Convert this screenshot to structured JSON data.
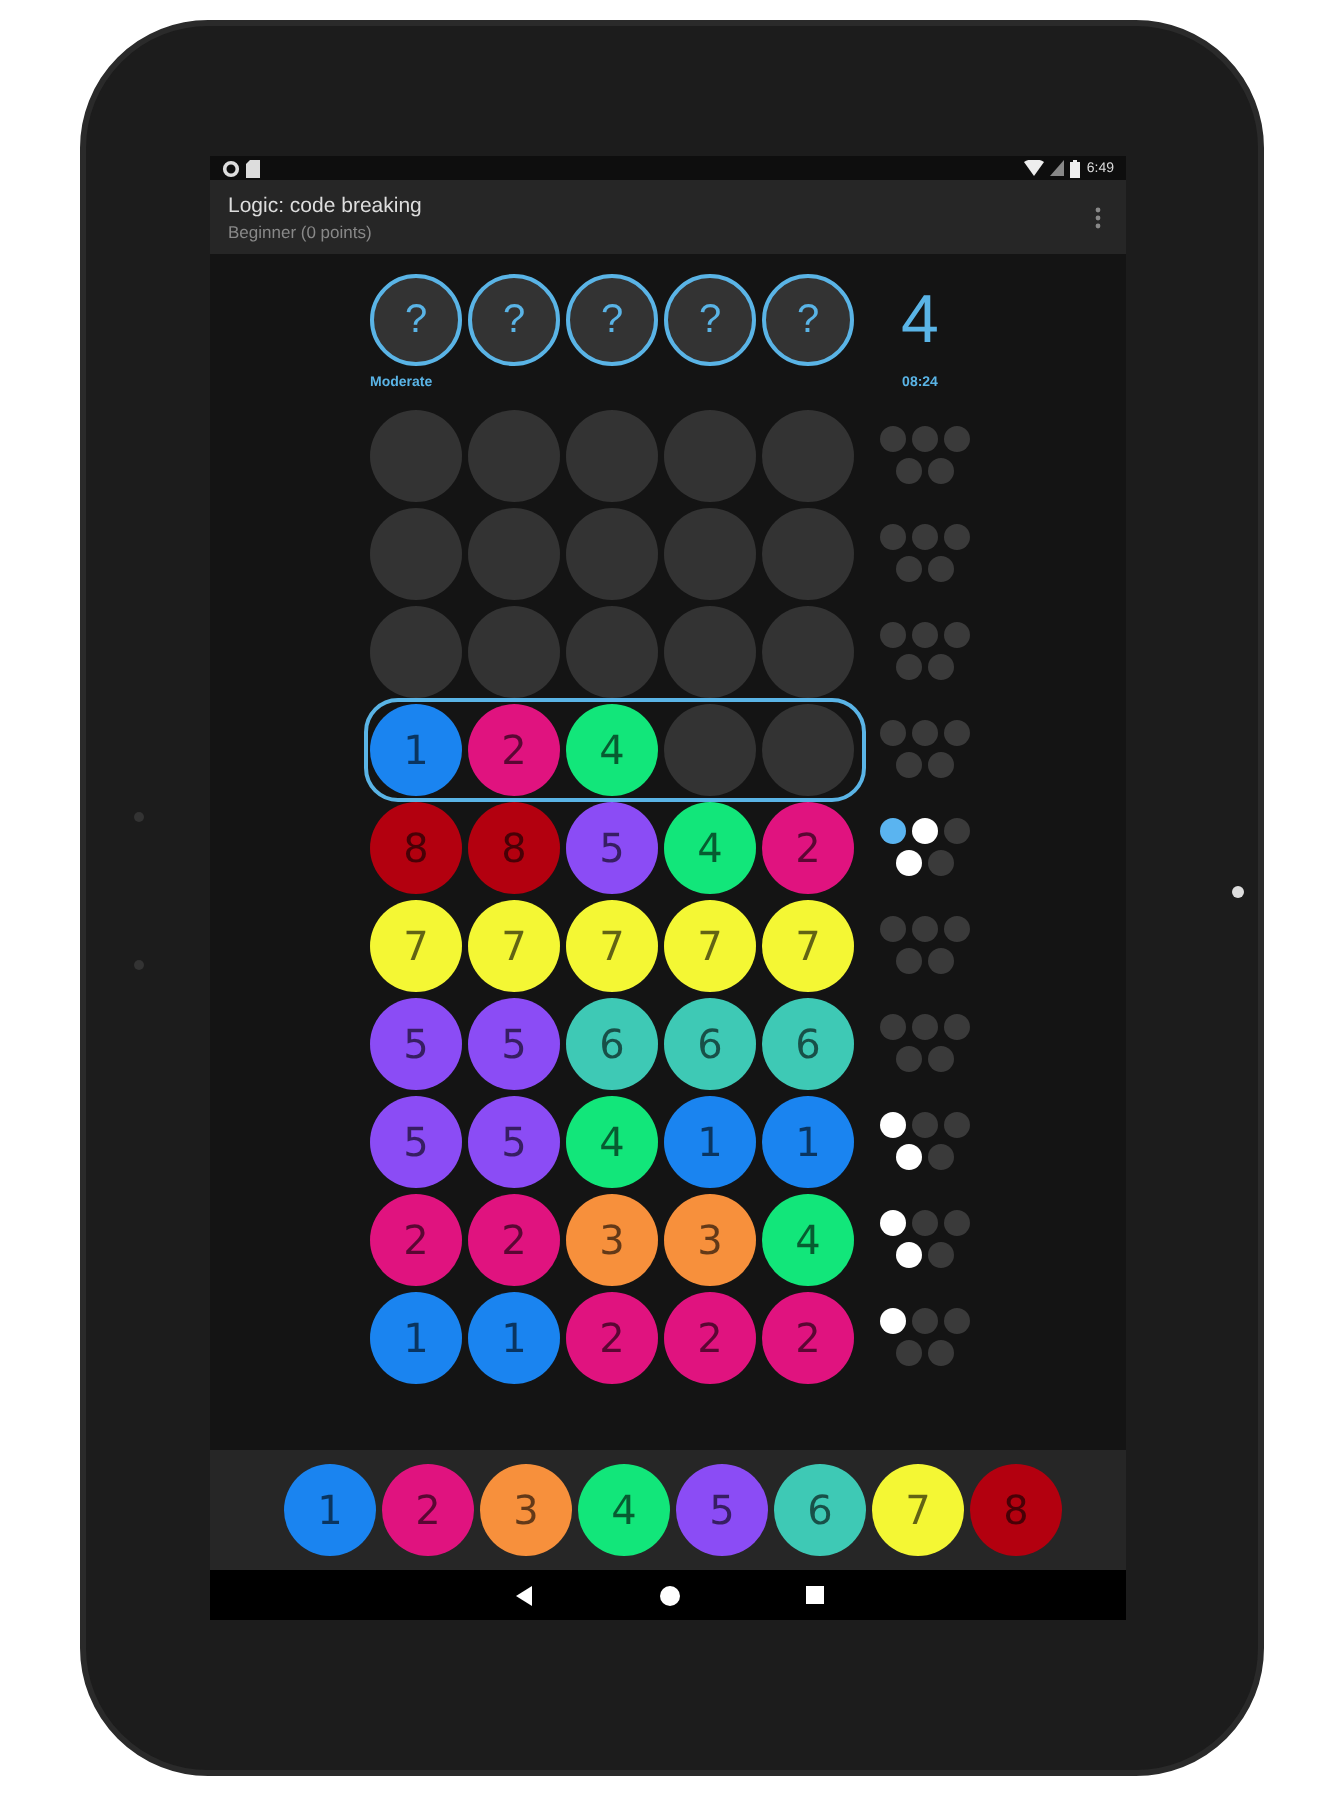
{
  "status_bar": {
    "time": "6:49"
  },
  "app_bar": {
    "title": "Logic: code breaking",
    "subtitle": "Beginner (0 points)"
  },
  "secret": [
    "?",
    "?",
    "?",
    "?",
    "?"
  ],
  "difficulty": "Moderate",
  "attempts": "4",
  "timer": "08:24",
  "rows": [
    {
      "selected": false,
      "slots": [
        {
          "kind": "empty"
        },
        {
          "kind": "empty"
        },
        {
          "kind": "empty"
        },
        {
          "kind": "empty"
        },
        {
          "kind": "empty"
        }
      ],
      "feedback": [
        {
          "color": "#3a3a3a"
        },
        {
          "color": "#3a3a3a"
        },
        {
          "color": "#3a3a3a"
        },
        {
          "color": "#3a3a3a"
        },
        {
          "color": "#3a3a3a"
        }
      ]
    },
    {
      "selected": false,
      "slots": [
        {
          "kind": "empty"
        },
        {
          "kind": "empty"
        },
        {
          "kind": "empty"
        },
        {
          "kind": "empty"
        },
        {
          "kind": "empty"
        }
      ],
      "feedback": [
        {
          "color": "#3a3a3a"
        },
        {
          "color": "#3a3a3a"
        },
        {
          "color": "#3a3a3a"
        },
        {
          "color": "#3a3a3a"
        },
        {
          "color": "#3a3a3a"
        }
      ]
    },
    {
      "selected": false,
      "slots": [
        {
          "kind": "empty"
        },
        {
          "kind": "empty"
        },
        {
          "kind": "empty"
        },
        {
          "kind": "empty"
        },
        {
          "kind": "empty"
        }
      ],
      "feedback": [
        {
          "color": "#3a3a3a"
        },
        {
          "color": "#3a3a3a"
        },
        {
          "color": "#3a3a3a"
        },
        {
          "color": "#3a3a3a"
        },
        {
          "color": "#3a3a3a"
        }
      ]
    },
    {
      "selected": true,
      "slots": [
        {
          "kind": "peg",
          "label": "1",
          "color": "#1a84f0"
        },
        {
          "kind": "peg",
          "label": "2",
          "color": "#e0137f"
        },
        {
          "kind": "peg",
          "label": "4",
          "color": "#12e67a"
        },
        {
          "kind": "empty"
        },
        {
          "kind": "empty"
        }
      ],
      "feedback": [
        {
          "color": "#3a3a3a"
        },
        {
          "color": "#3a3a3a"
        },
        {
          "color": "#3a3a3a"
        },
        {
          "color": "#3a3a3a"
        },
        {
          "color": "#3a3a3a"
        }
      ]
    },
    {
      "selected": false,
      "slots": [
        {
          "kind": "peg",
          "label": "8",
          "color": "#b3000f"
        },
        {
          "kind": "peg",
          "label": "8",
          "color": "#b3000f"
        },
        {
          "kind": "peg",
          "label": "5",
          "color": "#8b4cf5"
        },
        {
          "kind": "peg",
          "label": "4",
          "color": "#12e67a"
        },
        {
          "kind": "peg",
          "label": "2",
          "color": "#e0137f"
        }
      ],
      "feedback": [
        {
          "color": "#5ab4f0"
        },
        {
          "color": "#ffffff"
        },
        {
          "color": "#3a3a3a"
        },
        {
          "color": "#ffffff"
        },
        {
          "color": "#3a3a3a"
        }
      ]
    },
    {
      "selected": false,
      "slots": [
        {
          "kind": "peg",
          "label": "7",
          "color": "#f4f734"
        },
        {
          "kind": "peg",
          "label": "7",
          "color": "#f4f734"
        },
        {
          "kind": "peg",
          "label": "7",
          "color": "#f4f734"
        },
        {
          "kind": "peg",
          "label": "7",
          "color": "#f4f734"
        },
        {
          "kind": "peg",
          "label": "7",
          "color": "#f4f734"
        }
      ],
      "feedback": [
        {
          "color": "#3a3a3a"
        },
        {
          "color": "#3a3a3a"
        },
        {
          "color": "#3a3a3a"
        },
        {
          "color": "#3a3a3a"
        },
        {
          "color": "#3a3a3a"
        }
      ]
    },
    {
      "selected": false,
      "slots": [
        {
          "kind": "peg",
          "label": "5",
          "color": "#8b4cf5"
        },
        {
          "kind": "peg",
          "label": "5",
          "color": "#8b4cf5"
        },
        {
          "kind": "peg",
          "label": "6",
          "color": "#3ec9b5"
        },
        {
          "kind": "peg",
          "label": "6",
          "color": "#3ec9b5"
        },
        {
          "kind": "peg",
          "label": "6",
          "color": "#3ec9b5"
        }
      ],
      "feedback": [
        {
          "color": "#3a3a3a"
        },
        {
          "color": "#3a3a3a"
        },
        {
          "color": "#3a3a3a"
        },
        {
          "color": "#3a3a3a"
        },
        {
          "color": "#3a3a3a"
        }
      ]
    },
    {
      "selected": false,
      "slots": [
        {
          "kind": "peg",
          "label": "5",
          "color": "#8b4cf5"
        },
        {
          "kind": "peg",
          "label": "5",
          "color": "#8b4cf5"
        },
        {
          "kind": "peg",
          "label": "4",
          "color": "#12e67a"
        },
        {
          "kind": "peg",
          "label": "1",
          "color": "#1a84f0"
        },
        {
          "kind": "peg",
          "label": "1",
          "color": "#1a84f0"
        }
      ],
      "feedback": [
        {
          "color": "#ffffff"
        },
        {
          "color": "#3a3a3a"
        },
        {
          "color": "#3a3a3a"
        },
        {
          "color": "#ffffff"
        },
        {
          "color": "#3a3a3a"
        }
      ]
    },
    {
      "selected": false,
      "slots": [
        {
          "kind": "peg",
          "label": "2",
          "color": "#e0137f"
        },
        {
          "kind": "peg",
          "label": "2",
          "color": "#e0137f"
        },
        {
          "kind": "peg",
          "label": "3",
          "color": "#f7903c"
        },
        {
          "kind": "peg",
          "label": "3",
          "color": "#f7903c"
        },
        {
          "kind": "peg",
          "label": "4",
          "color": "#12e67a"
        }
      ],
      "feedback": [
        {
          "color": "#ffffff"
        },
        {
          "color": "#3a3a3a"
        },
        {
          "color": "#3a3a3a"
        },
        {
          "color": "#ffffff"
        },
        {
          "color": "#3a3a3a"
        }
      ]
    },
    {
      "selected": false,
      "slots": [
        {
          "kind": "peg",
          "label": "1",
          "color": "#1a84f0"
        },
        {
          "kind": "peg",
          "label": "1",
          "color": "#1a84f0"
        },
        {
          "kind": "peg",
          "label": "2",
          "color": "#e0137f"
        },
        {
          "kind": "peg",
          "label": "2",
          "color": "#e0137f"
        },
        {
          "kind": "peg",
          "label": "2",
          "color": "#e0137f"
        }
      ],
      "feedback": [
        {
          "color": "#ffffff"
        },
        {
          "color": "#3a3a3a"
        },
        {
          "color": "#3a3a3a"
        },
        {
          "color": "#3a3a3a"
        },
        {
          "color": "#3a3a3a"
        }
      ]
    }
  ],
  "palette": [
    {
      "label": "1",
      "color": "#1a84f0"
    },
    {
      "label": "2",
      "color": "#e0137f"
    },
    {
      "label": "3",
      "color": "#f7903c"
    },
    {
      "label": "4",
      "color": "#12e67a"
    },
    {
      "label": "5",
      "color": "#8b4cf5"
    },
    {
      "label": "6",
      "color": "#3ec9b5"
    },
    {
      "label": "7",
      "color": "#f4f734"
    },
    {
      "label": "8",
      "color": "#b3000f"
    }
  ]
}
